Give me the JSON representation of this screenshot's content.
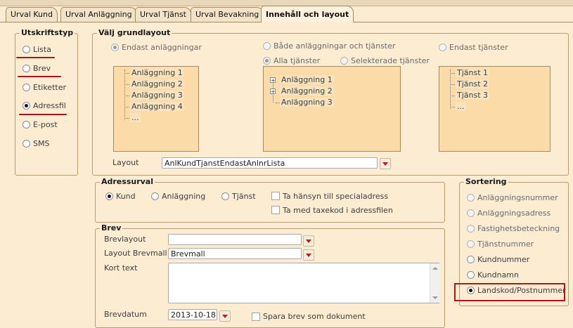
{
  "tabs": [
    {
      "label": "Urval Kund"
    },
    {
      "label": "Urval Anläggning"
    },
    {
      "label": "Urval Tjänst"
    },
    {
      "label": "Urval Bevakning"
    },
    {
      "label": "Innehåll och layout",
      "active": true
    }
  ],
  "utskriftstyp": {
    "title": "Utskriftstyp",
    "options": [
      "Lista",
      "Brev",
      "Etiketter",
      "Adressfil",
      "E-post",
      "SMS"
    ],
    "selected": "Adressfil"
  },
  "grundlayout": {
    "title": "Välj grundlayout",
    "opt_endast_anl": "Endast anläggningar",
    "opt_bade": "Både anläggningar och tjänster",
    "opt_alla_tjanster": "Alla tjänster",
    "opt_selekterade": "Selekterade tjänster",
    "opt_endast_tjanster": "Endast tjänster",
    "preview_left": [
      "Anläggning 1",
      "Anläggning 2",
      "Anläggning 3",
      "Anläggning 4",
      "..."
    ],
    "preview_mid": [
      "Anläggning 1",
      "Anläggning 2",
      "Anläggning 3"
    ],
    "preview_right": [
      "Tjänst 1",
      "Tjänst 2",
      "Tjänst 3",
      "..."
    ],
    "layout_label": "Layout",
    "layout_value": "AnlKundTjanstEndastAnlnrLista"
  },
  "adressurval": {
    "title": "Adressurval",
    "opt_kund": "Kund",
    "opt_anlaggning": "Anläggning",
    "opt_tjanst": "Tjänst",
    "chk_special": "Ta hänsyn till specialadress",
    "chk_taxekod": "Ta med taxekod i adressfilen"
  },
  "brev": {
    "title": "Brev",
    "brevlayout_label": "Brevlayout",
    "brevlayout_value": "",
    "brevmall_label": "Layout Brevmall",
    "brevmall_value": "Brevmall",
    "korttext_label": "Kort text",
    "korttext_value": "",
    "brevdatum_label": "Brevdatum",
    "brevdatum_value": "2013-10-18",
    "spara_label": "Spara brev som dokument"
  },
  "sortering": {
    "title": "Sortering",
    "options": [
      "Anläggningsnummer",
      "Anläggningsadress",
      "Fastighetsbeteckning",
      "Tjänstnummer",
      "Kundnummer",
      "Kundnamn",
      "Landskod/Postnummer"
    ],
    "selected": "Landskod/Postnummer"
  },
  "colors": {
    "annotation_red": "#b3141b",
    "panel_bg": "#fcecd2",
    "preview_bg": "#fbdca8"
  }
}
